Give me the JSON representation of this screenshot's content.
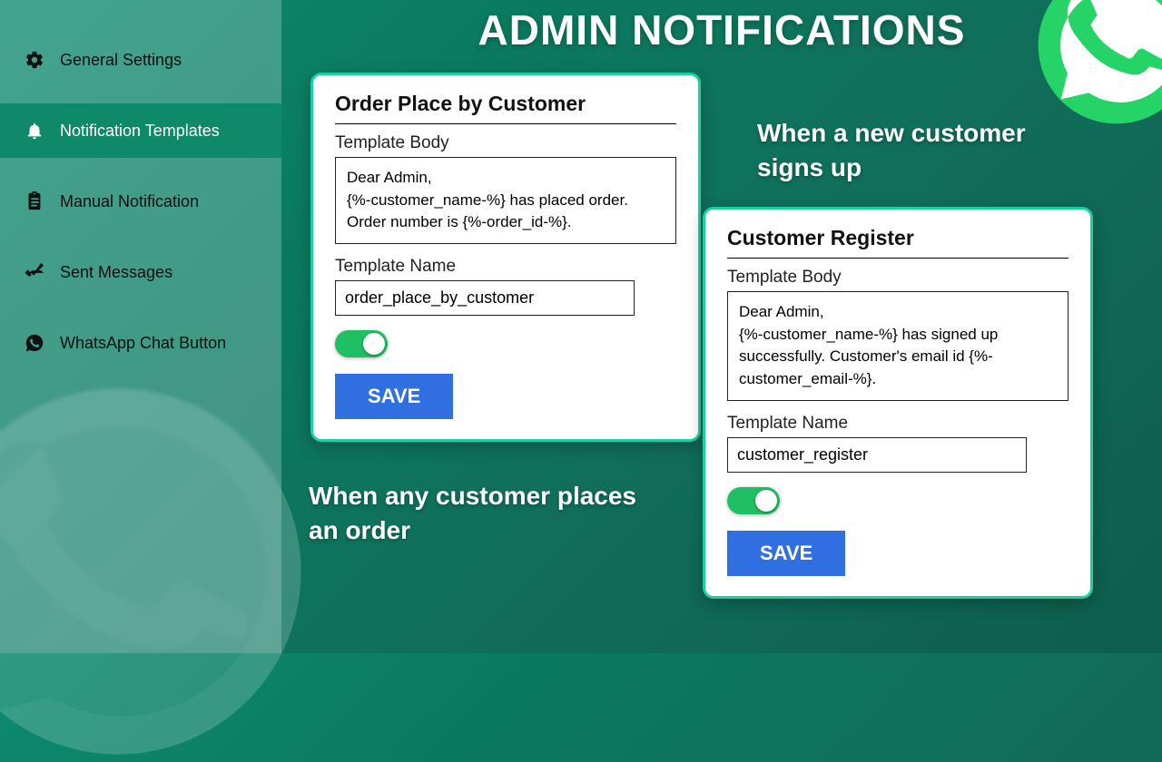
{
  "header": {
    "title": "ADMIN NOTIFICATIONS"
  },
  "sidebar": {
    "items": [
      {
        "label": "General Settings",
        "icon": "gear-icon"
      },
      {
        "label": "Notification Templates",
        "icon": "bell-icon",
        "active": true
      },
      {
        "label": "Manual Notification",
        "icon": "clipboard-icon"
      },
      {
        "label": "Sent Messages",
        "icon": "double-check-icon"
      },
      {
        "label": "WhatsApp Chat Button",
        "icon": "whatsapp-icon"
      }
    ]
  },
  "cards": {
    "order_place": {
      "title": "Order Place by Customer",
      "body_label": "Template Body",
      "body": "Dear Admin,\n{%-customer_name-%} has placed order. Order number is {%-order_id-%}.",
      "name_label": "Template Name",
      "name_value": "order_place_by_customer",
      "toggle_on": true,
      "save_label": "SAVE"
    },
    "customer_register": {
      "title": "Customer Register",
      "body_label": "Template Body",
      "body": "Dear Admin,\n{%-customer_name-%} has signed up successfully. Customer's email id {%-customer_email-%}.",
      "name_label": "Template Name",
      "name_value": "customer_register",
      "toggle_on": true,
      "save_label": "SAVE"
    }
  },
  "callouts": {
    "c1": "When any customer places an order",
    "c2": "When a new customer signs up"
  }
}
